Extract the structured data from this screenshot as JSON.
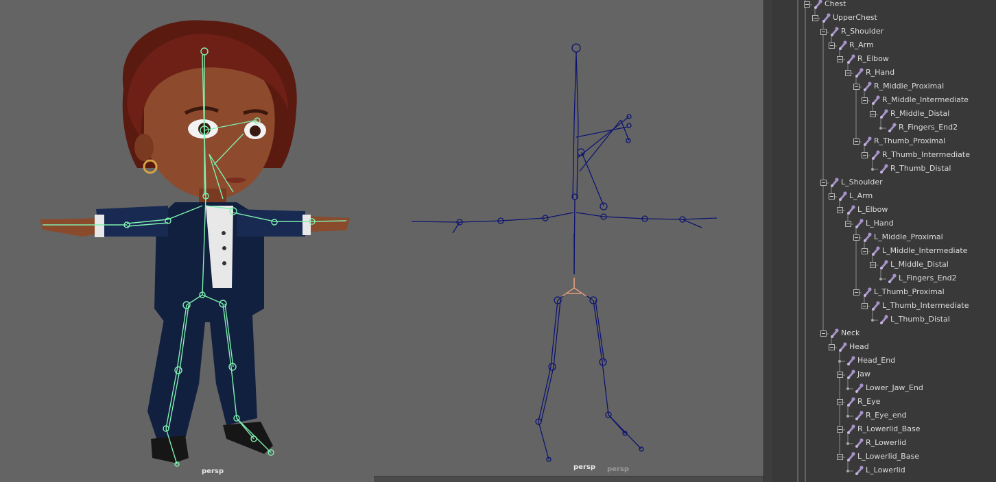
{
  "viewports": [
    {
      "label": "persp"
    },
    {
      "label": "persp",
      "label2": "persp"
    }
  ],
  "outliner": {
    "rows": [
      {
        "label": "Chest",
        "depth": 0,
        "expanded": true
      },
      {
        "label": "UpperChest",
        "depth": 1,
        "expanded": true
      },
      {
        "label": "R_Shoulder",
        "depth": 2,
        "expanded": true
      },
      {
        "label": "R_Arm",
        "depth": 3,
        "expanded": true
      },
      {
        "label": "R_Elbow",
        "depth": 4,
        "expanded": true
      },
      {
        "label": "R_Hand",
        "depth": 5,
        "expanded": true
      },
      {
        "label": "R_Middle_Proximal",
        "depth": 6,
        "expanded": true
      },
      {
        "label": "R_Middle_Intermediate",
        "depth": 7,
        "expanded": true
      },
      {
        "label": "R_Middle_Distal",
        "depth": 8,
        "expanded": true
      },
      {
        "label": "R_Fingers_End2",
        "depth": 9,
        "expanded": false
      },
      {
        "label": "R_Thumb_Proximal",
        "depth": 6,
        "expanded": true
      },
      {
        "label": "R_Thumb_Intermediate",
        "depth": 7,
        "expanded": true
      },
      {
        "label": "R_Thumb_Distal",
        "depth": 8,
        "expanded": false
      },
      {
        "label": "L_Shoulder",
        "depth": 2,
        "expanded": true
      },
      {
        "label": "L_Arm",
        "depth": 3,
        "expanded": true
      },
      {
        "label": "L_Elbow",
        "depth": 4,
        "expanded": true
      },
      {
        "label": "L_Hand",
        "depth": 5,
        "expanded": true
      },
      {
        "label": "L_Middle_Proximal",
        "depth": 6,
        "expanded": true
      },
      {
        "label": "L_Middle_Intermediate",
        "depth": 7,
        "expanded": true
      },
      {
        "label": "L_Middle_Distal",
        "depth": 8,
        "expanded": true
      },
      {
        "label": "L_Fingers_End2",
        "depth": 9,
        "expanded": false
      },
      {
        "label": "L_Thumb_Proximal",
        "depth": 6,
        "expanded": true
      },
      {
        "label": "L_Thumb_Intermediate",
        "depth": 7,
        "expanded": true
      },
      {
        "label": "L_Thumb_Distal",
        "depth": 8,
        "expanded": false
      },
      {
        "label": "Neck",
        "depth": 2,
        "expanded": true
      },
      {
        "label": "Head",
        "depth": 3,
        "expanded": true
      },
      {
        "label": "Head_End",
        "depth": 4,
        "expanded": false
      },
      {
        "label": "Jaw",
        "depth": 4,
        "expanded": true
      },
      {
        "label": "Lower_Jaw_End",
        "depth": 5,
        "expanded": false
      },
      {
        "label": "R_Eye",
        "depth": 4,
        "expanded": true
      },
      {
        "label": "R_Eye_end",
        "depth": 5,
        "expanded": false
      },
      {
        "label": "R_Lowerlid_Base",
        "depth": 4,
        "expanded": true
      },
      {
        "label": "R_Lowerlid",
        "depth": 5,
        "expanded": false
      },
      {
        "label": "L_Lowerlid_Base",
        "depth": 4,
        "expanded": true
      },
      {
        "label": "L_Lowerlid",
        "depth": 5,
        "expanded": false
      }
    ]
  },
  "colors": {
    "viewport_bg": "#646464",
    "outliner_bg": "#393939",
    "joint_selected": "#7ff0b0",
    "joint_unselected": "#0d1470",
    "joint_icon": "#a792c8",
    "root_highlight": "#e8a07a"
  },
  "icons": {
    "joint": "joint-icon",
    "expand": "collapse-box-icon",
    "leaf": "leaf-dot-icon"
  }
}
